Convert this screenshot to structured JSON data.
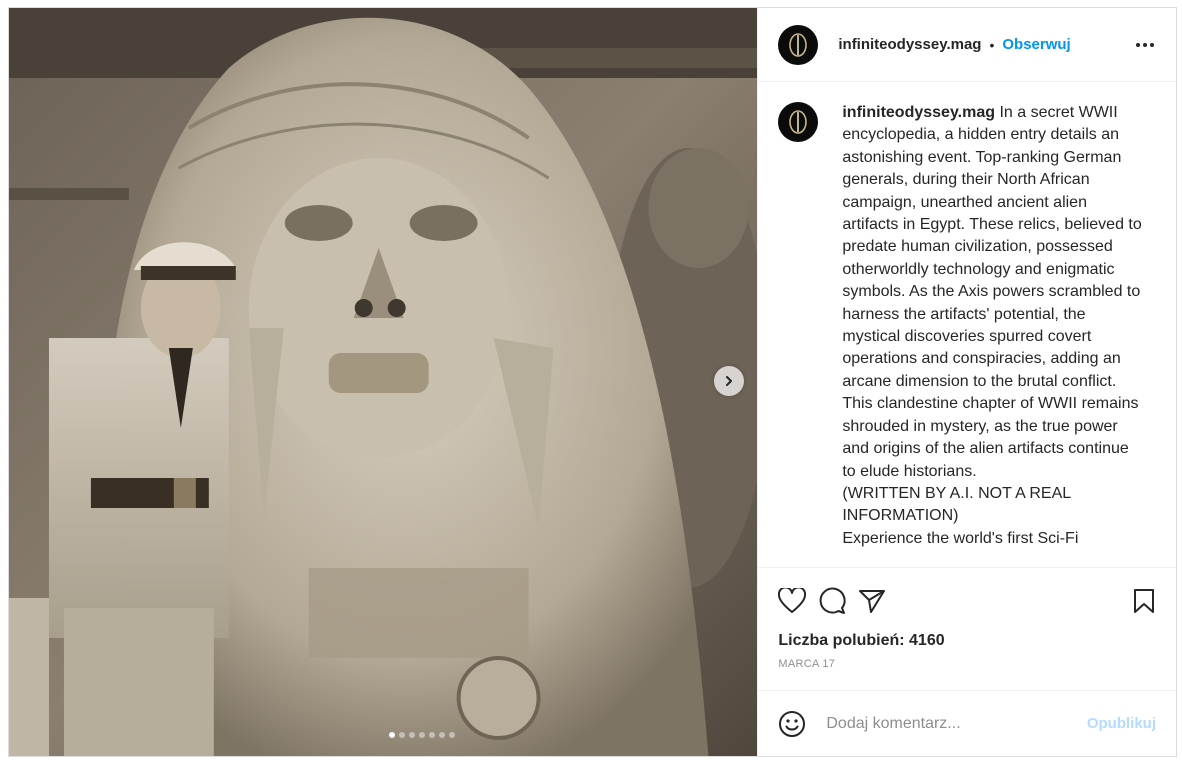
{
  "post": {
    "username": "infiniteodyssey.mag",
    "separator": "•",
    "follow_label": "Obserwuj",
    "caption": {
      "username": "infiniteodyssey.mag",
      "text": "In a secret WWII encyclopedia, a hidden entry details an astonishing event. Top-ranking German generals, during their North African campaign, unearthed ancient alien artifacts in Egypt. These relics, believed to predate human civilization, possessed otherworldly technology and enigmatic symbols. As the Axis powers scrambled to harness the artifacts' potential, the mystical discoveries spurred covert operations and conspiracies, adding an arcane dimension to the brutal conflict. This clandestine chapter of WWII remains shrouded in mystery, as the true power and origins of the alien artifacts continue to elude historians.",
      "disclaimer_line1": "(WRITTEN BY A.I. NOT A REAL",
      "disclaimer_line2": "INFORMATION)",
      "more_text": "Experience the world's first Sci-Fi"
    },
    "likes_text": "Liczba polubień: 4160",
    "date": "MARCA 17",
    "comment": {
      "placeholder": "Dodaj komentarz...",
      "publish_label": "Opublikuj"
    },
    "carousel": {
      "slide_count": 7,
      "active_index": 0
    }
  },
  "colors": {
    "accent": "#0095f6",
    "publish_disabled": "#b3dbff",
    "text": "#262626",
    "muted": "#8e8e8e"
  },
  "icons": {
    "more": "more-horizontal-icon",
    "like": "heart-icon",
    "comment": "comment-icon",
    "share": "paper-plane-icon",
    "save": "bookmark-icon",
    "emoji": "emoji-icon",
    "next": "chevron-right-icon"
  }
}
